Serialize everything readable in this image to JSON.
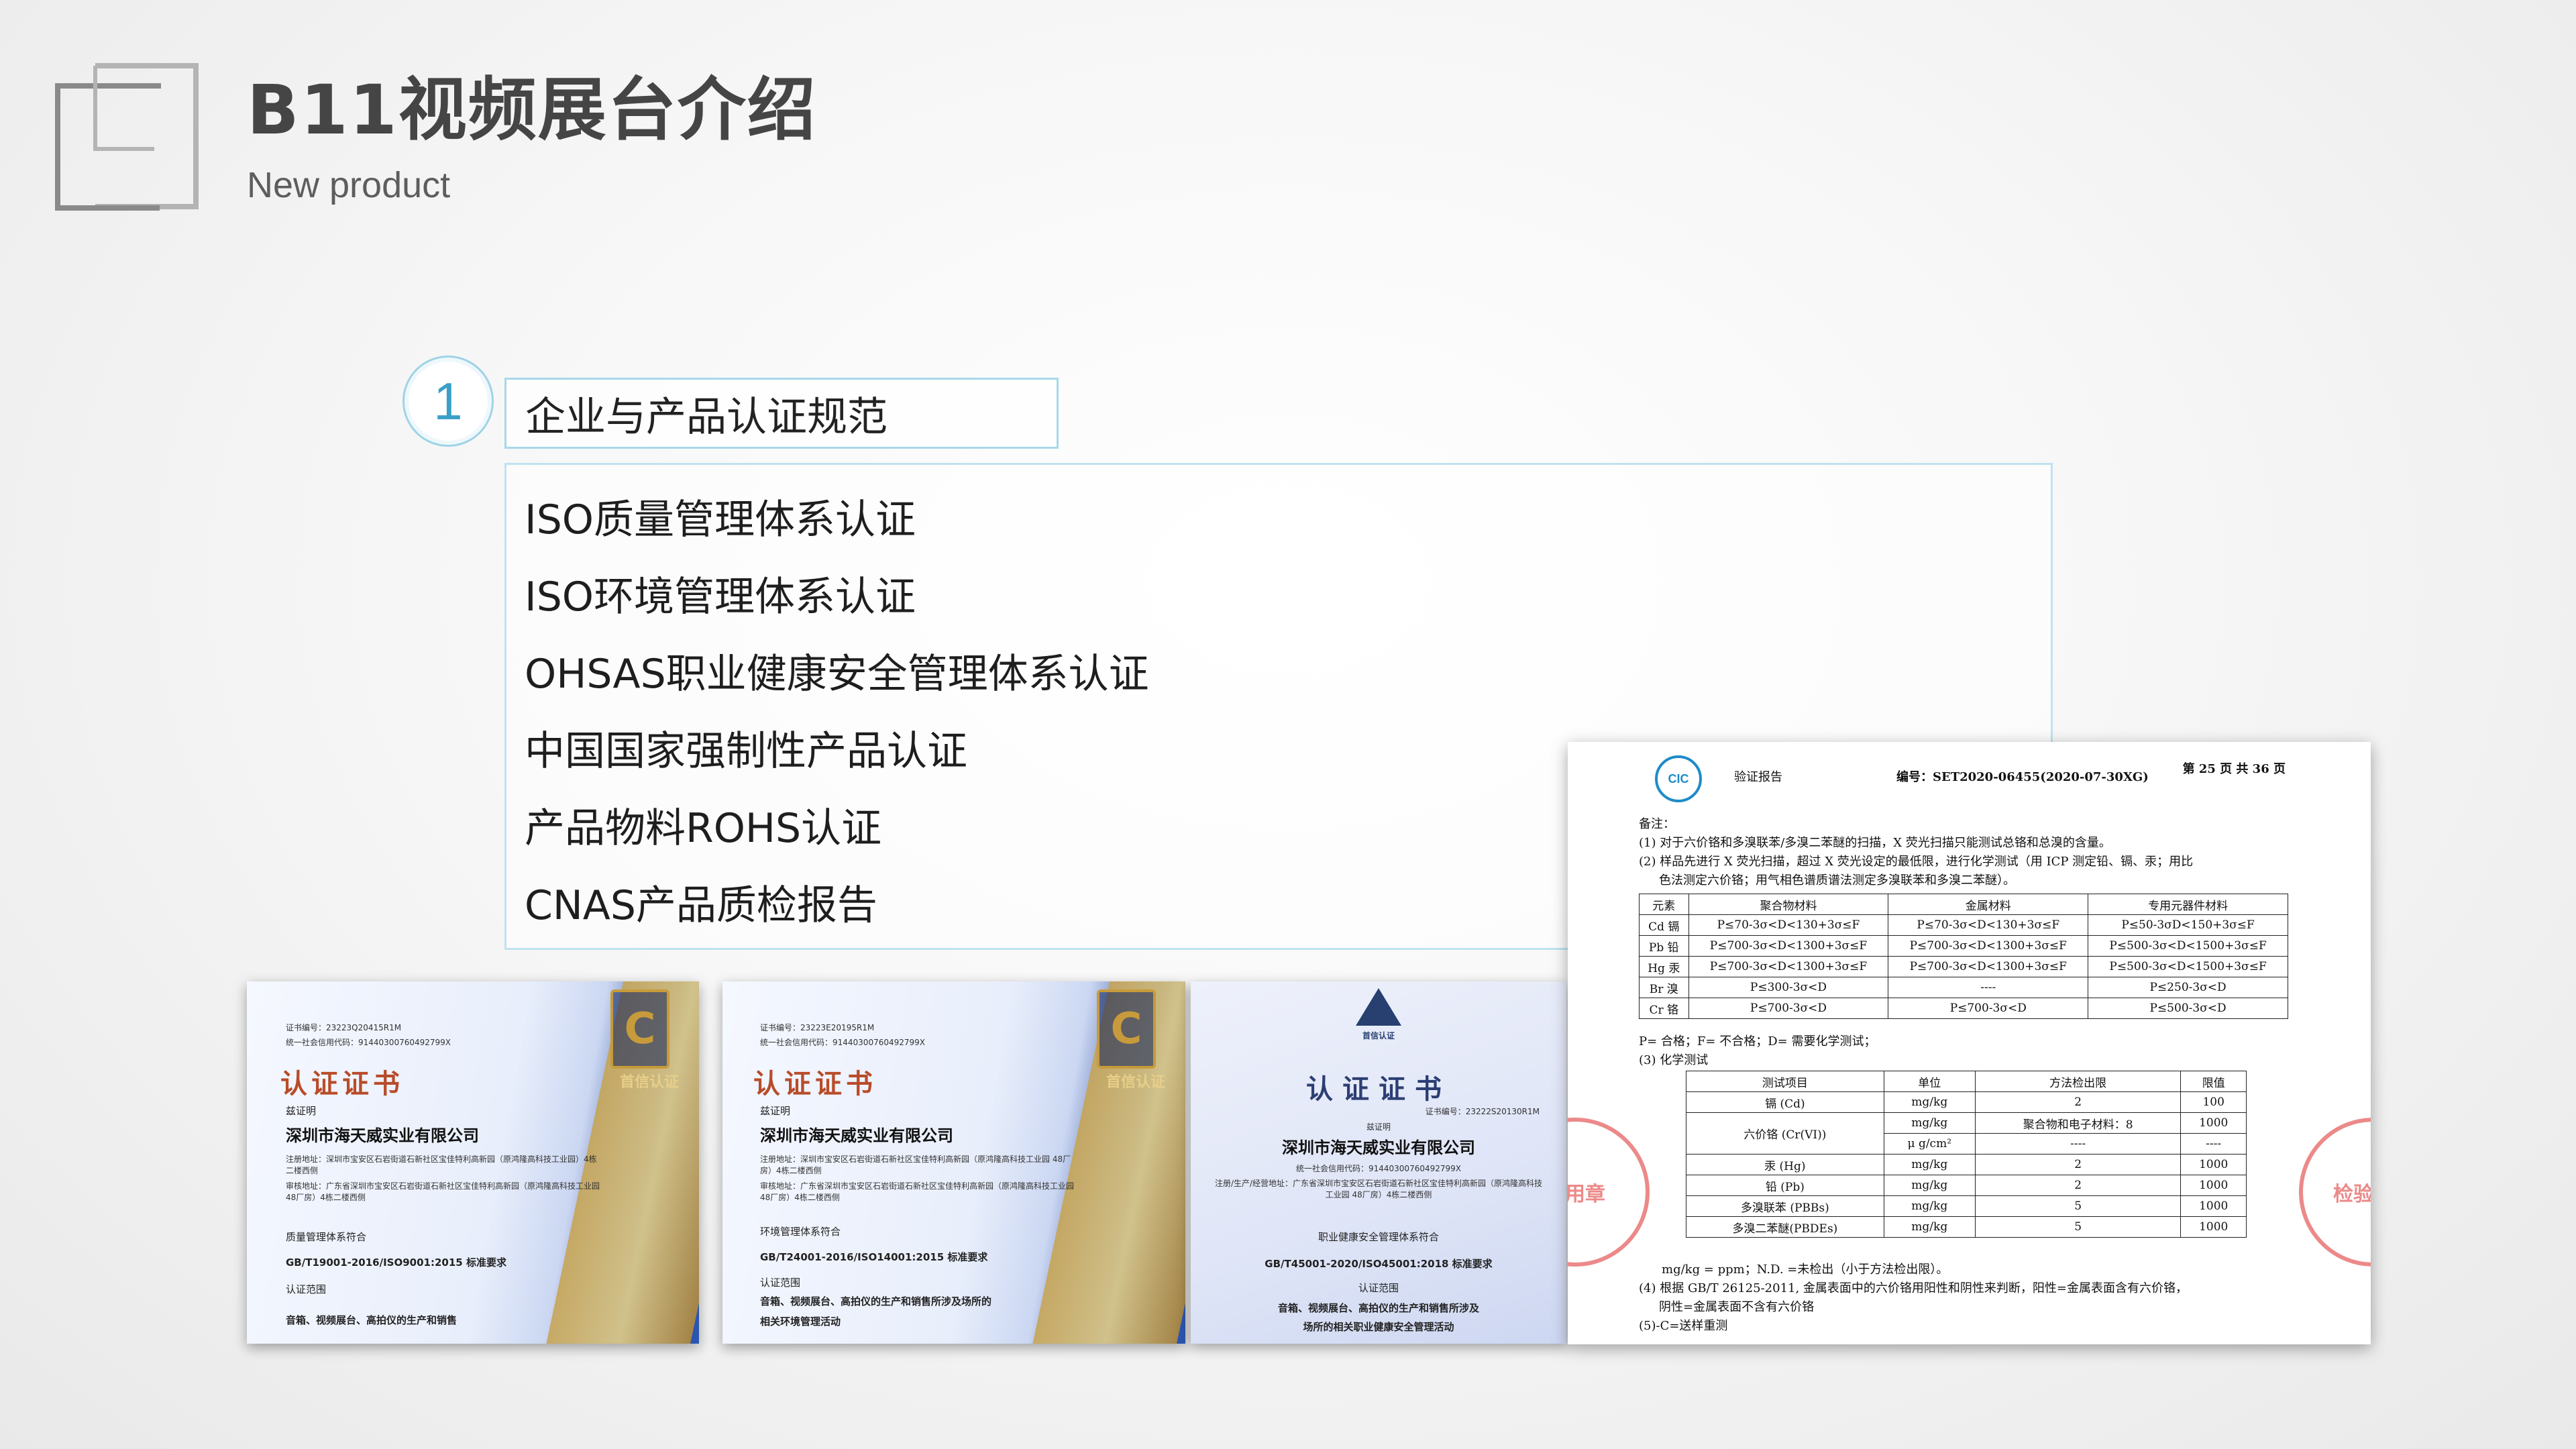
{
  "header": {
    "title": "B11视频展台介绍",
    "subtitle": "New product"
  },
  "section": {
    "number": "1",
    "heading": "企业与产品认证规范",
    "items": [
      "ISO质量管理体系认证",
      "ISO环境管理体系认证",
      "OHSAS职业健康安全管理体系认证",
      "中国国家强制性产品认证",
      "产品物料ROHS认证",
      "CNAS产品质检报告"
    ]
  },
  "certificates": [
    {
      "cert_no": "证书编号：23223Q20415R1M",
      "credit_code": "统一社会信用代码：91440300760492799X",
      "heading": "认证证书",
      "confirm": "兹证明",
      "company": "深圳市海天威实业有限公司",
      "reg_address": "注册地址：深圳市宝安区石岩街道石新社区宝佳特利高新园（原鸿隆高科技工业园）4栋二楼西侧",
      "audit_address": "审核地址：广东省深圳市宝安区石岩街道石新社区宝佳特利高新园（原鸿隆高科技工业园 48厂房）4栋二楼西侧",
      "system": "质量管理体系符合",
      "standard": "GB/T19001-2016/ISO9001:2015 标准要求",
      "scope_label": "认证范围",
      "scope": "音箱、视频展台、高拍仪的生产和销售",
      "emblem_label": "首信认证"
    },
    {
      "cert_no": "证书编号：23223E20195R1M",
      "credit_code": "统一社会信用代码：91440300760492799X",
      "heading": "认证证书",
      "confirm": "兹证明",
      "company": "深圳市海天威实业有限公司",
      "reg_address": "注册地址：深圳市宝安区石岩街道石新社区宝佳特利高新园（原鸿隆高科技工业园 48厂房）4栋二楼西侧",
      "audit_address": "审核地址：广东省深圳市宝安区石岩街道石新社区宝佳特利高新园（原鸿隆高科技工业园 48厂房）4栋二楼西侧",
      "system": "环境管理体系符合",
      "standard": "GB/T24001-2016/ISO14001:2015 标准要求",
      "scope_label": "认证范围",
      "scope": "音箱、视频展台、高拍仪的生产和销售所涉及场所的",
      "scope2": "相关环境管理活动",
      "emblem_label": "首信认证"
    },
    {
      "cert_no": "证书编号：23222S20130R1M",
      "heading": "认证证书",
      "emblem_label": "首信认证",
      "confirm": "兹证明",
      "company": "深圳市海天威实业有限公司",
      "credit_code": "统一社会信用代码：91440300760492799X",
      "address": "注册/生产/经营地址：广东省深圳市宝安区石岩街道石新社区宝佳特利高新园（原鸿隆高科技工业园 48厂房）4栋二楼西侧",
      "system": "职业健康安全管理体系符合",
      "standard": "GB/T45001-2020/ISO45001:2018 标准要求",
      "scope_label": "认证范围",
      "scope": "音箱、视频展台、高拍仪的生产和销售所涉及",
      "scope2": "场所的相关职业健康安全管理活动"
    }
  ],
  "report": {
    "logo": "CIC",
    "title": "验证报告",
    "number": "编号：SET2020-06455(2020-07-30XG)",
    "page": "第 25 页 共 36 页",
    "notes_label": "备注：",
    "note1": "(1) 对于六价铬和多溴联苯/多溴二苯醚的扫描，X 荧光扫描只能测试总铬和总溴的含量。",
    "note2a": "(2) 样品先进行 X 荧光扫描，超过 X 荧光设定的最低限，进行化学测试（用 ICP 测定铅、镉、汞；用比",
    "note2b": "色法测定六价铬；用气相色谱质谱法测定多溴联苯和多溴二苯醚）。",
    "table1": {
      "headers": [
        "元素",
        "聚合物材料",
        "金属材料",
        "专用元器件材料"
      ],
      "rows": [
        [
          "Cd 镉",
          "P≤70-3σ<D<130+3σ≤F",
          "P≤70-3σ<D<130+3σ≤F",
          "P≤50-3σD<150+3σ≤F"
        ],
        [
          "Pb 铅",
          "P≤700-3σ<D<1300+3σ≤F",
          "P≤700-3σ<D<1300+3σ≤F",
          "P≤500-3σ<D<1500+3σ≤F"
        ],
        [
          "Hg 汞",
          "P≤700-3σ<D<1300+3σ≤F",
          "P≤700-3σ<D<1300+3σ≤F",
          "P≤500-3σ<D<1500+3σ≤F"
        ],
        [
          "Br 溴",
          "P≤300-3σ<D",
          "----",
          "P≤250-3σ<D"
        ],
        [
          "Cr 铬",
          "P≤700-3σ<D",
          "P≤700-3σ<D",
          "P≤500-3σ<D"
        ]
      ]
    },
    "legend": "P= 合格；F= 不合格；D= 需要化学测试；",
    "chem_label": "(3) 化学测试",
    "table2": {
      "headers": [
        "测试项目",
        "单位",
        "方法检出限",
        "限值"
      ],
      "rows": [
        [
          "镉 (Cd)",
          "mg/kg",
          "2",
          "100"
        ],
        [
          "六价铬 (Cr(VI))",
          "mg/kg",
          "聚合物和电子材料：8",
          "1000"
        ],
        [
          "",
          "μ g/cm²",
          "----",
          "----"
        ],
        [
          "汞 (Hg)",
          "mg/kg",
          "2",
          "1000"
        ],
        [
          "铅 (Pb)",
          "mg/kg",
          "2",
          "1000"
        ],
        [
          "多溴联苯 (PBBs)",
          "mg/kg",
          "5",
          "1000"
        ],
        [
          "多溴二苯醚(PBDEs)",
          "mg/kg",
          "5",
          "1000"
        ]
      ]
    },
    "unit_note": "mg/kg = ppm；N.D. =未检出（小于方法检出限）。",
    "note4a": "(4) 根据 GB/T 26125-2011, 金属表面中的六价铬用阳性和阴性来判断，阳性=金属表面含有六价铬，",
    "note4b": "阴性=金属表面不含有六价铬",
    "note5": "(5)-C=送样重测",
    "stamp_left": "专用章",
    "stamp_right": "检验检测"
  }
}
